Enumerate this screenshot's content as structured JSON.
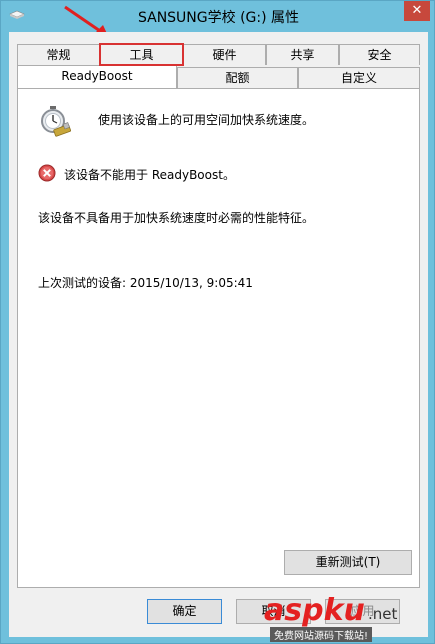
{
  "window": {
    "title": "SANSUNG学校 (G:) 属性",
    "close_glyph": "✕"
  },
  "tabs_row1": [
    {
      "label": "常规"
    },
    {
      "label": "工具"
    },
    {
      "label": "硬件"
    },
    {
      "label": "共享"
    },
    {
      "label": "安全"
    }
  ],
  "tabs_row2": [
    {
      "label": "ReadyBoost"
    },
    {
      "label": "配额"
    },
    {
      "label": "自定义"
    }
  ],
  "panel": {
    "info_text": "使用该设备上的可用空间加快系统速度。",
    "error_text": "该设备不能用于 ReadyBoost。",
    "reason_text": "该设备不具备用于加快系统速度时必需的性能特征。",
    "last_test_text": "上次测试的设备: 2015/10/13, 9:05:41",
    "retest_button": "重新测试(T)"
  },
  "footer": {
    "ok_button": "确定",
    "cancel_button": "取消",
    "apply_button": "应用"
  },
  "watermark": {
    "brand": "aspku",
    "suffix": ".net",
    "sub": "免费网站源码下载站!"
  },
  "colors": {
    "window_frame": "#6fc0dc",
    "highlight_box": "#d83232",
    "arrow": "#e02020"
  }
}
